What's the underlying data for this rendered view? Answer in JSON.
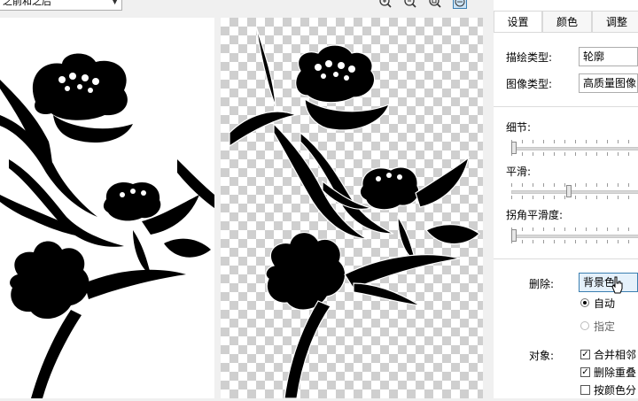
{
  "toolbar": {
    "view_option": "之前和之后",
    "zoom_icons": [
      "zoom-in-icon",
      "zoom-out-icon",
      "zoom-fit-icon",
      "pan-icon"
    ]
  },
  "panel": {
    "tabs": [
      {
        "label": "设置",
        "active": true
      },
      {
        "label": "颜色",
        "active": false
      },
      {
        "label": "调整",
        "active": false
      }
    ],
    "trace_type_label": "描绘类型:",
    "trace_type_value": "轮廓",
    "image_type_label": "图像类型:",
    "image_type_value": "高质量图像",
    "detail_label": "细节:",
    "smoothing_label": "平滑:",
    "corner_smoothness_label": "拐角平滑度:",
    "detail_level": 0.0,
    "smoothing_level": 0.45,
    "corner_smoothness_level": 0.0,
    "delete_label": "删除:",
    "delete_value": "背景色",
    "radio_auto": "自动",
    "radio_specify": "指定",
    "object_label": "对象:",
    "check_merge": "合并相邻",
    "check_remove_overlap": "删除重叠",
    "check_by_color": "按颜色分"
  },
  "colors": {
    "accent": "#3c7fb1",
    "checker": "#cfcfcf"
  }
}
